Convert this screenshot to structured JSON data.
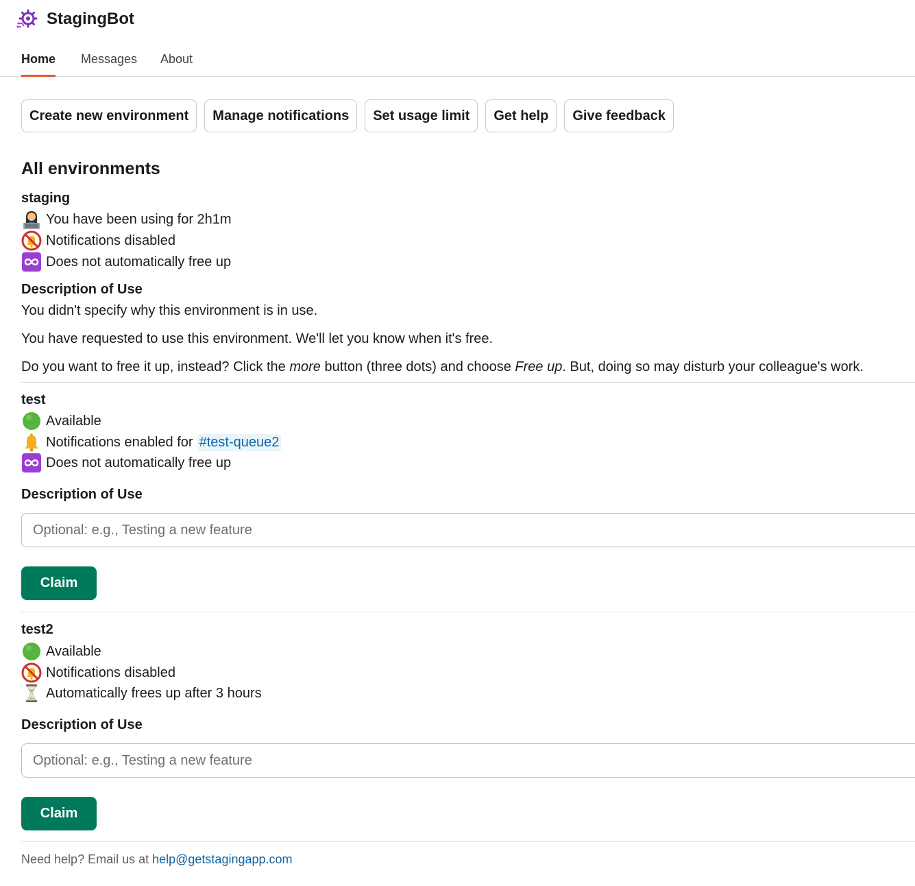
{
  "app": {
    "title": "StagingBot",
    "logo_icon": "gear-bot-icon",
    "accent_color": "#7b2fbf"
  },
  "tabs": [
    {
      "label": "Home",
      "active": true
    },
    {
      "label": "Messages",
      "active": false
    },
    {
      "label": "About",
      "active": false
    }
  ],
  "actions": [
    "Create new environment",
    "Manage notifications",
    "Set usage limit",
    "Get help",
    "Give feedback"
  ],
  "section_title": "All environments",
  "environments": [
    {
      "name": "staging",
      "status": [
        {
          "icon": "person-at-laptop-icon",
          "text": "You have been using for 2h1m"
        },
        {
          "icon": "bell-disabled-icon",
          "text": "Notifications disabled"
        },
        {
          "icon": "infinity-icon",
          "text": "Does not automatically free up"
        }
      ],
      "description_label": "Description of Use",
      "description_text": "You didn't specify why this environment is in use.",
      "request_text": "You have requested to use this environment. We'll let you know when it's free.",
      "free_up_text": {
        "part1": "Do you want to free it up, instead? Click the ",
        "more": "more",
        "part2": " button (three dots) and choose ",
        "free_up": "Free up",
        "part3": ". But, doing so may disturb your colleague's work."
      }
    },
    {
      "name": "test",
      "status": [
        {
          "icon": "green-circle-icon",
          "text": "Available"
        },
        {
          "icon": "bell-icon",
          "text": "Notifications enabled for",
          "channel": "#test-queue2"
        },
        {
          "icon": "infinity-icon",
          "text": "Does not automatically free up"
        }
      ],
      "description_label": "Description of Use",
      "input_placeholder": "Optional: e.g., Testing a new feature",
      "input_value": "",
      "claim_label": "Claim"
    },
    {
      "name": "test2",
      "status": [
        {
          "icon": "green-circle-icon",
          "text": "Available"
        },
        {
          "icon": "bell-disabled-icon",
          "text": "Notifications disabled"
        },
        {
          "icon": "hourglass-icon",
          "text": "Automatically frees up after 3 hours"
        }
      ],
      "description_label": "Description of Use",
      "input_placeholder": "Optional: e.g., Testing a new feature",
      "input_value": "",
      "claim_label": "Claim"
    }
  ],
  "footer": {
    "text": "Need help? Email us at ",
    "email": "help@getstagingapp.com"
  },
  "colors": {
    "claim_green": "#007a5a",
    "tab_underline": "#e8562a",
    "link_blue": "#1264a3"
  }
}
